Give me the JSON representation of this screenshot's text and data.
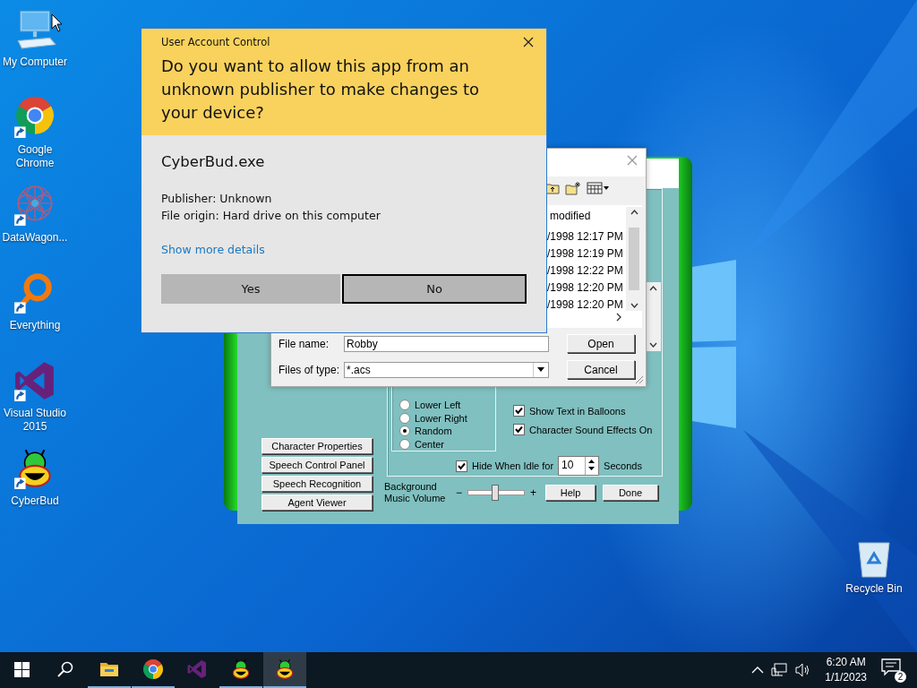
{
  "desktop_icons": [
    {
      "label": "My Computer",
      "kind": "computer",
      "shortcut": false
    },
    {
      "label": "Google Chrome",
      "kind": "chrome",
      "shortcut": true
    },
    {
      "label": "DataWagon...",
      "kind": "lattice",
      "shortcut": true
    },
    {
      "label": "Everything",
      "kind": "ring",
      "shortcut": true
    },
    {
      "label": "Visual Studio 2015",
      "kind": "vs",
      "shortcut": true
    },
    {
      "label": "CyberBud",
      "kind": "bug",
      "shortcut": true
    }
  ],
  "recycle_bin": {
    "label": "Recycle Bin"
  },
  "agent_window": {
    "side_buttons": [
      "Character Properties",
      "Speech Control Panel",
      "Speech Recognition",
      "Agent Viewer"
    ],
    "positions": [
      {
        "label": "Lower Left",
        "selected": false
      },
      {
        "label": "Lower Right",
        "selected": false
      },
      {
        "label": "Random",
        "selected": true
      },
      {
        "label": "Center",
        "selected": false
      }
    ],
    "options": [
      {
        "label": "Show Text in Balloons",
        "checked": true
      },
      {
        "label": "Character Sound Effects On",
        "checked": true
      }
    ],
    "hide_idle": {
      "label": "Hide When Idle for",
      "checked": true,
      "value": "10",
      "unit": "Seconds"
    },
    "volume": {
      "label": "Background Music Volume",
      "minus": "−",
      "plus": "+",
      "level": 0.47
    },
    "buttons": [
      "Help",
      "Done"
    ]
  },
  "file_dialog": {
    "column_header": "modified",
    "rows": [
      "/1998 12:17 PM",
      "/1998 12:19 PM",
      "/1998 12:22 PM",
      "/1998 12:20 PM",
      "/1998 12:20 PM"
    ],
    "file_name": {
      "label": "File name:",
      "value": "Robby"
    },
    "file_type": {
      "label": "Files of type:",
      "value": "*.acs"
    },
    "buttons": [
      "Open",
      "Cancel"
    ]
  },
  "uac": {
    "title": "User Account Control",
    "question": "Do you want to allow this app from an unknown publisher to make changes to your device?",
    "app_name": "CyberBud.exe",
    "details": [
      "Publisher: Unknown",
      "File origin: Hard drive on this computer"
    ],
    "link": "Show more details",
    "buttons": [
      {
        "label": "Yes",
        "focused": false
      },
      {
        "label": "No",
        "focused": true
      }
    ]
  },
  "taskbar": {
    "apps": [
      {
        "kind": "folder",
        "running": true,
        "active": false
      },
      {
        "kind": "chrome",
        "running": true,
        "active": false
      },
      {
        "kind": "vs",
        "running": false,
        "active": false
      },
      {
        "kind": "bug",
        "running": true,
        "active": false
      },
      {
        "kind": "bug",
        "running": true,
        "active": true
      }
    ],
    "time": "6:20 AM",
    "date": "1/1/2023",
    "notifications": "2"
  }
}
